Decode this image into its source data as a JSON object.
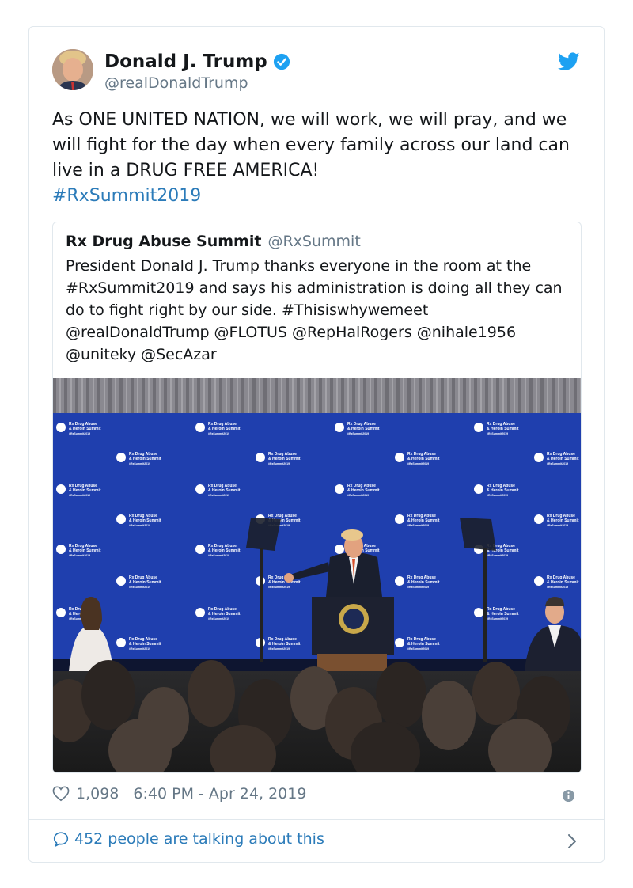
{
  "tweet": {
    "display_name": "Donald J. Trump",
    "handle": "@realDonaldTrump",
    "text": "As ONE UNITED NATION, we will work, we will pray, and we will fight for the day when every family across our land can live in a DRUG FREE AMERICA!",
    "hashtag": "#RxSummit2019",
    "likes": "1,098",
    "timestamp": "6:40 PM - Apr 24, 2019",
    "talking": "452 people are talking about this"
  },
  "quoted": {
    "name": "Rx Drug Abuse Summit",
    "handle": "@RxSummit",
    "text": "President Donald J. Trump thanks everyone in the room at the #RxSummit2019 and says his administration is doing all they can do to fight right by our side. #Thisiswhywemeet @realDonaldTrump @FLOTUS @RepHalRogers @nihale1956 @uniteky @SecAzar"
  },
  "photo": {
    "backdrop_lines": [
      "Rx Drug Abuse",
      "& Heroin Summit",
      "#RxSummit2019"
    ]
  },
  "colors": {
    "link": "#2b7bb9",
    "verified": "#1da1f2",
    "backdrop": "#1f3fae",
    "muted": "#657786"
  },
  "icons": [
    "verified-badge-icon",
    "twitter-bird-icon",
    "heart-icon",
    "info-icon",
    "comment-bubble-icon",
    "chevron-right-icon"
  ]
}
